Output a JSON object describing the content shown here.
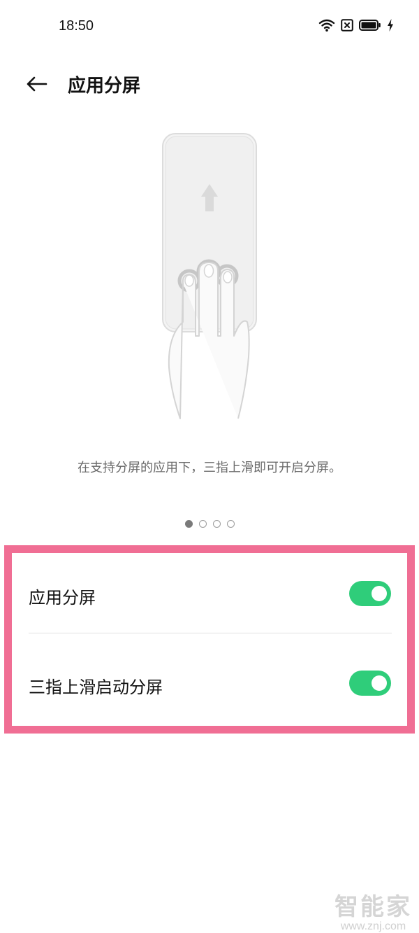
{
  "status_bar": {
    "time": "18:50"
  },
  "header": {
    "title": "应用分屏"
  },
  "illustration": {
    "icon": "three-finger-swipe-up-illustration"
  },
  "description": "在支持分屏的应用下，三指上滑即可开启分屏。",
  "pager": {
    "count": 4,
    "active_index": 0
  },
  "settings": [
    {
      "label": "应用分屏",
      "enabled": true
    },
    {
      "label": "三指上滑启动分屏",
      "enabled": true
    }
  ],
  "colors": {
    "toggle_on": "#2fcd7a",
    "highlight_border": "#f06e94"
  },
  "watermark": {
    "title": "智能家",
    "url": "www.znj.com"
  }
}
